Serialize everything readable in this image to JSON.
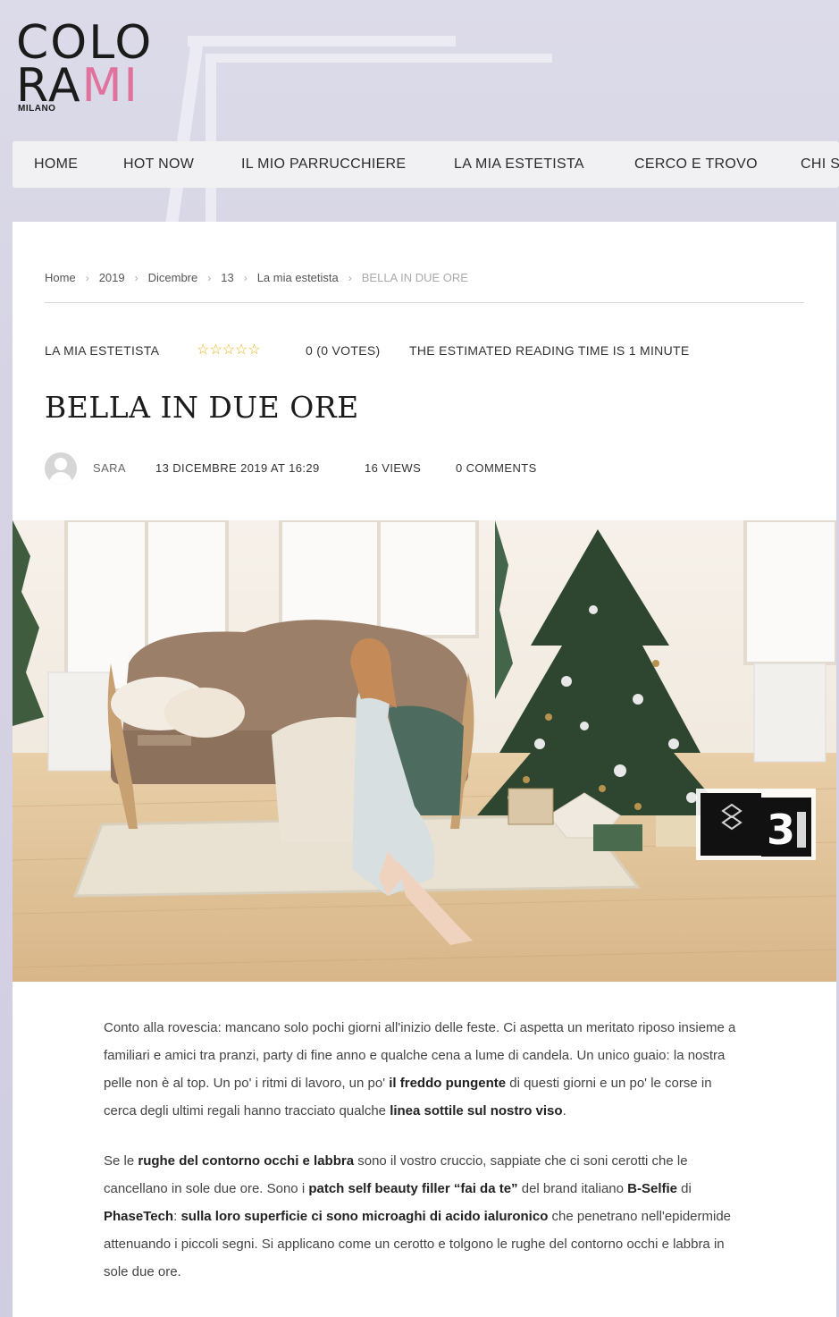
{
  "logo": {
    "line1": "COLO",
    "line2_a": "RA",
    "line2_b": "MI",
    "city": "MILANO",
    "accent": "#e0739d"
  },
  "nav": {
    "items": [
      "HOME",
      "HOT NOW",
      "IL MIO PARRUCCHIERE",
      "LA MIA ESTETISTA",
      "CERCO E TROVO",
      "CHI S"
    ]
  },
  "breadcrumb": {
    "items": [
      "Home",
      "2019",
      "Dicembre",
      "13",
      "La mia estetista"
    ],
    "current": "BELLA IN DUE ORE",
    "separator": "›"
  },
  "post_meta": {
    "category": "LA MIA ESTETISTA",
    "stars": "☆☆☆☆☆",
    "rating_text": "0 (0 VOTES)",
    "reading_time": "THE ESTIMATED READING TIME IS 1 MINUTE",
    "star_color": "#e7b21c"
  },
  "title": "BELLA IN DUE ORE",
  "author": {
    "name": "SARA",
    "date": "13 DICEMBRE 2019 AT 16:29",
    "views": "16 VIEWS",
    "comments": "0 COMMENTS"
  },
  "hero_image": {
    "icon": "christmas-living-room-photo",
    "badge_text": "3"
  },
  "article": {
    "p1": [
      {
        "t": "Conto alla rovescia: mancano solo pochi giorni all'inizio delle feste. Ci aspetta un meritato riposo insieme a familiari e amici tra pranzi, party di fine anno e qualche cena a lume di candela.  Un unico guaio: la nostra pelle non è al top. Un po' i ritmi di lavoro, un po' ",
        "b": false
      },
      {
        "t": "il freddo pungente",
        "b": true
      },
      {
        "t": " di questi giorni e un po' le corse in cerca degli ultimi regali hanno tracciato qualche ",
        "b": false
      },
      {
        "t": "linea sottile sul nostro viso",
        "b": true
      },
      {
        "t": ".",
        "b": false
      }
    ],
    "p2": [
      {
        "t": "Se le ",
        "b": false
      },
      {
        "t": "rughe del contorno occhi e labbra",
        "b": true
      },
      {
        "t": " sono il vostro cruccio, sappiate che ci soni cerotti che le cancellano in sole due ore. Sono i ",
        "b": false
      },
      {
        "t": "patch self beauty filler “fai da te”",
        "b": true
      },
      {
        "t": " del brand italiano ",
        "b": false
      },
      {
        "t": "B-Selfie",
        "b": true
      },
      {
        "t": " di ",
        "b": false
      },
      {
        "t": "PhaseTech",
        "b": true
      },
      {
        "t": ": ",
        "b": false
      },
      {
        "t": "sulla loro superficie ci sono microaghi di acido ialuronico",
        "b": true
      },
      {
        "t": " che penetrano nell'epidermide attenuando i piccoli segni. Si applicano come un cerotto e tolgono le rughe del contorno occhi e labbra in sole due ore.",
        "b": false
      }
    ]
  }
}
